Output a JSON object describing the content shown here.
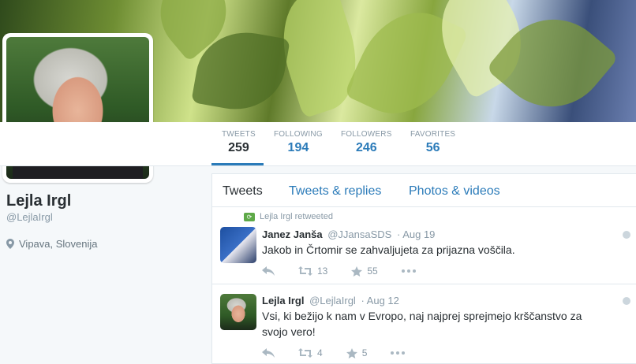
{
  "profile": {
    "name": "Lejla Irgl",
    "handle": "@LejlaIrgl",
    "location": "Vipava, Slovenija"
  },
  "stats": [
    {
      "label": "TWEETS",
      "value": "259"
    },
    {
      "label": "FOLLOWING",
      "value": "194"
    },
    {
      "label": "FOLLOWERS",
      "value": "246"
    },
    {
      "label": "FAVORITES",
      "value": "56"
    }
  ],
  "tabs": [
    "Tweets",
    "Tweets & replies",
    "Photos & videos"
  ],
  "tweets": [
    {
      "retweet_note": "Lejla Irgl retweeted",
      "name": "Janez Janša",
      "handle": "@JJansaSDS",
      "date": "· Aug 19",
      "text": "Jakob in Črtomir se zahvaljujeta za prijazna voščila.",
      "retweets": "13",
      "favorites": "55"
    },
    {
      "name": "Lejla Irgl",
      "handle": "@LejlaIrgl",
      "date": "· Aug 12",
      "text": "Vsi, ki bežijo k nam v Evropo, naj najprej sprejmejo krščanstvo za svojo vero!",
      "retweets": "4",
      "favorites": "5"
    }
  ],
  "icons": {
    "location": "map-pin-icon",
    "reply": "reply-icon",
    "retweet": "retweet-icon",
    "favorite": "star-icon",
    "more": "more-dots-icon",
    "caret": "caret-icon"
  },
  "colors": {
    "link": "#2b7bb9",
    "muted": "#8899a6",
    "retweet_green": "#5ea948"
  }
}
